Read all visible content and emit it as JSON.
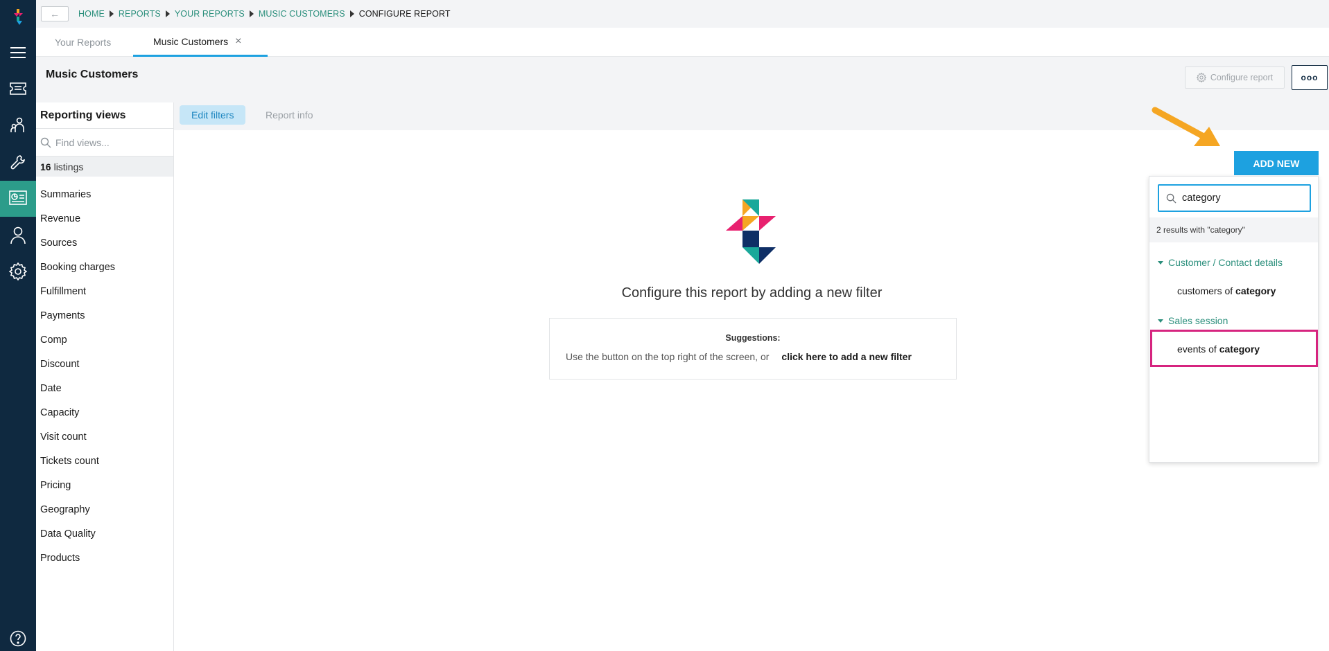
{
  "breadcrumb": {
    "back_icon": "←",
    "items": [
      "HOME",
      "REPORTS",
      "YOUR REPORTS",
      "MUSIC CUSTOMERS"
    ],
    "current": "CONFIGURE REPORT"
  },
  "tabs": [
    {
      "label": "Your Reports"
    },
    {
      "label": "Music Customers",
      "close_icon": "×"
    }
  ],
  "header": {
    "title": "Music Customers",
    "configure_label": "Configure report",
    "more_label": "ooo"
  },
  "subtabs": {
    "edit_filters": "Edit filters",
    "report_info": "Report info"
  },
  "sidebar": {
    "title": "Reporting views",
    "search_placeholder": "Find views...",
    "count": "16",
    "count_label": "listings",
    "items": [
      "Summaries",
      "Revenue",
      "Sources",
      "Booking charges",
      "Fulfillment",
      "Payments",
      "Comp",
      "Discount",
      "Date",
      "Capacity",
      "Visit count",
      "Tickets count",
      "Pricing",
      "Geography",
      "Data Quality",
      "Products"
    ]
  },
  "main": {
    "empty_message": "Configure this report by adding a new filter",
    "suggestions_heading": "Suggestions:",
    "suggestion_text": "Use the button on the top right of the screen, or",
    "suggestion_link": "click here to add a new filter",
    "add_new_label": "ADD NEW"
  },
  "dropdown": {
    "search_value": "category",
    "results_text": "2 results with \"category\"",
    "groups": [
      {
        "label": "Customer / Contact details",
        "item_prefix": "customers of ",
        "item_term": "category"
      },
      {
        "label": "Sales session",
        "item_prefix": "events of ",
        "item_term": "category"
      }
    ]
  },
  "colors": {
    "rail": "#0f2940",
    "accent_teal": "#2b8f7c",
    "accent_blue": "#1da1e0",
    "highlight": "#d6247f",
    "arrow": "#f5a623"
  },
  "icons": {
    "rail": [
      "app-logo-icon",
      "menu-icon",
      "ticket-icon",
      "users-icon",
      "wrench-icon",
      "reports-icon",
      "person-icon",
      "settings-icon",
      "help-icon"
    ]
  }
}
